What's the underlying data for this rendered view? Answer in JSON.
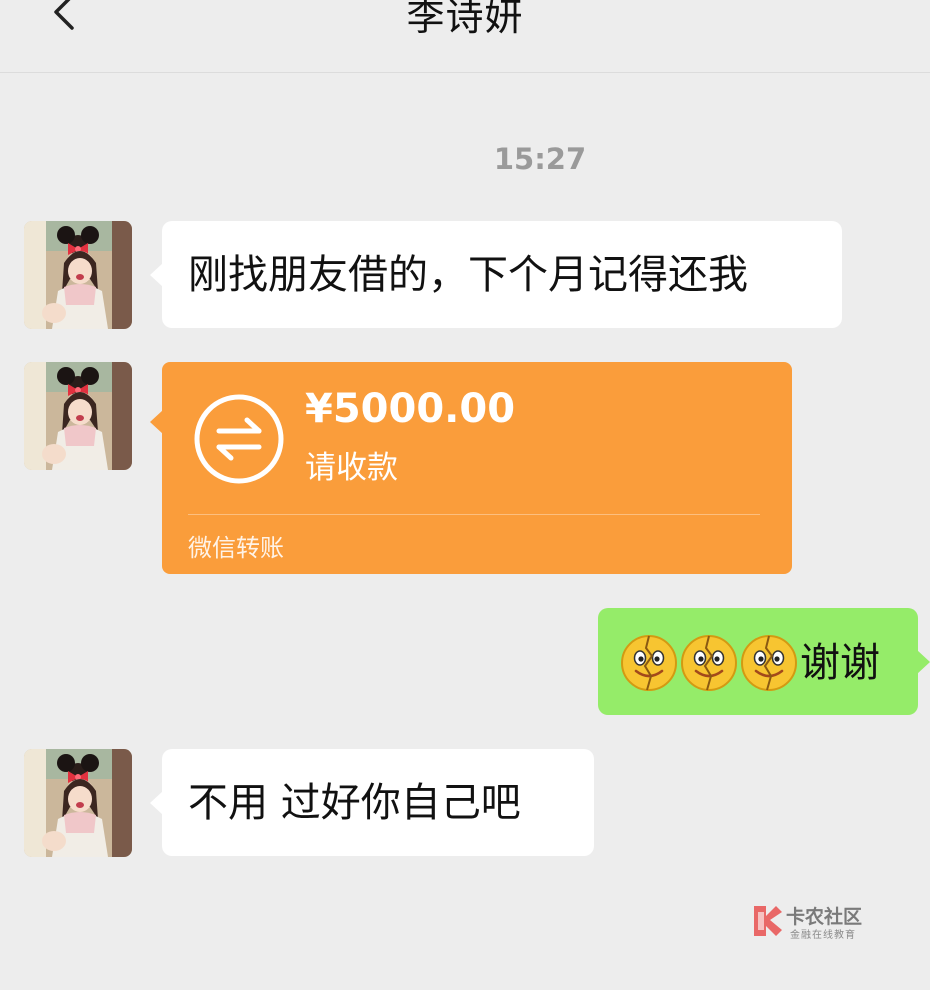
{
  "header": {
    "title": "李诗妍",
    "back_icon": "chevron-left-icon"
  },
  "chat": {
    "timestamp": "15:27",
    "messages": [
      {
        "sender": "contact",
        "type": "text",
        "text": "刚找朋友借的，下个月记得还我"
      },
      {
        "sender": "contact",
        "type": "transfer",
        "amount": "¥5000.00",
        "status": "请收款",
        "footer": "微信转账",
        "icon": "transfer-arrows-icon"
      },
      {
        "sender": "self",
        "type": "text",
        "emojis": [
          "cracked-smile-emoji",
          "cracked-smile-emoji",
          "cracked-smile-emoji"
        ],
        "text": "谢谢"
      },
      {
        "sender": "contact",
        "type": "text",
        "text": "不用 过好你自己吧"
      }
    ]
  },
  "watermark": {
    "main": "卡农社区",
    "sub": "金融在线教育"
  },
  "colors": {
    "background": "#ededed",
    "incoming_bubble": "#ffffff",
    "outgoing_bubble": "#95ec69",
    "transfer_bubble": "#fa9d3b"
  }
}
